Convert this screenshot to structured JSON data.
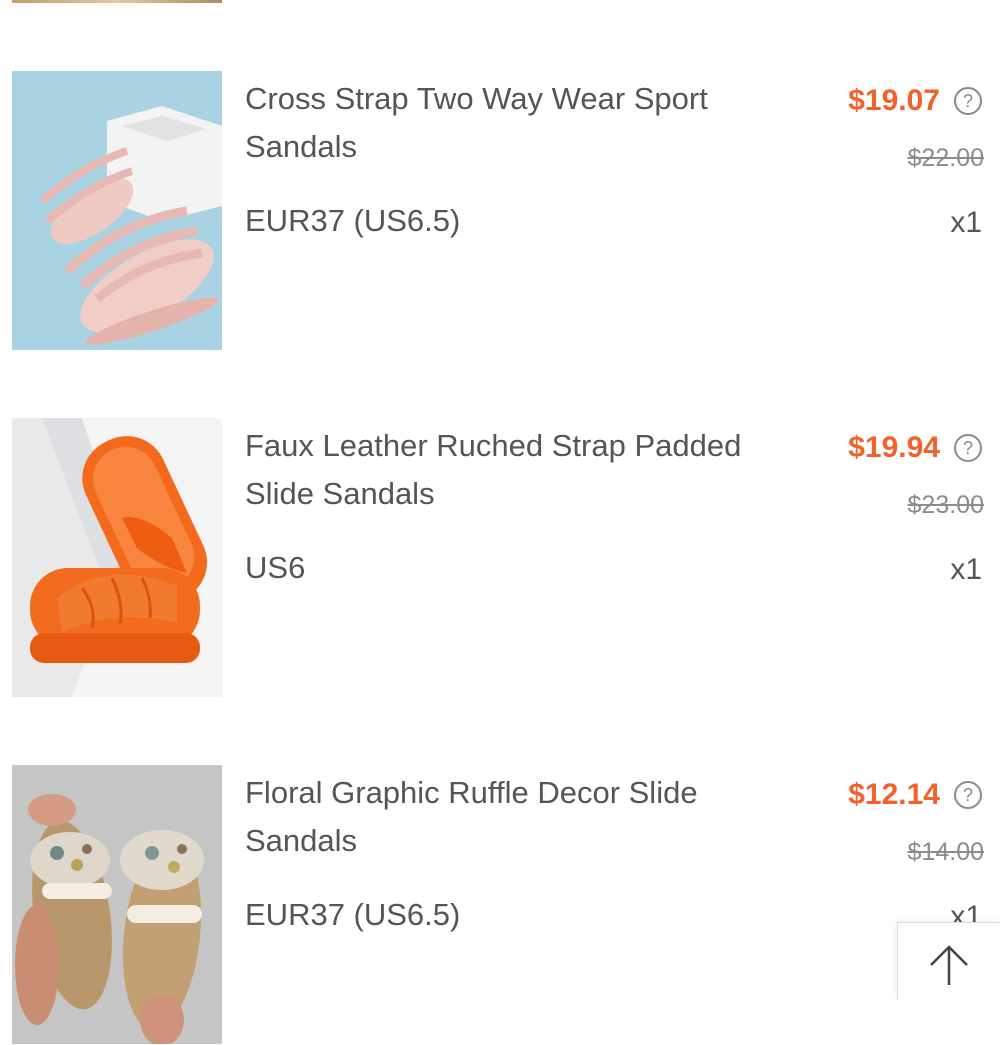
{
  "items": [
    {
      "title": "Cross Strap Two Way Wear Sport Sandals",
      "variant": "EUR37 (US6.5)",
      "price": "$19.07",
      "original_price": "$22.00",
      "quantity": "x1",
      "thumbnail": "pink-sport-sandals"
    },
    {
      "title": "Faux Leather Ruched Strap Padded Slide Sandals",
      "variant": "US6",
      "price": "$19.94",
      "original_price": "$23.00",
      "quantity": "x1",
      "thumbnail": "orange-slide-sandals"
    },
    {
      "title": "Floral Graphic Ruffle Decor Slide Sandals",
      "variant": "EUR37 (US6.5)",
      "price": "$12.14",
      "original_price": "$14.00",
      "quantity": "x1",
      "thumbnail": "floral-ruffle-sandals"
    }
  ],
  "icons": {
    "price_help": "question-circle-icon",
    "back_to_top": "arrow-up-icon"
  },
  "colors": {
    "price": "#f2622a",
    "text": "#555555",
    "original_price": "#8c8c8c"
  }
}
